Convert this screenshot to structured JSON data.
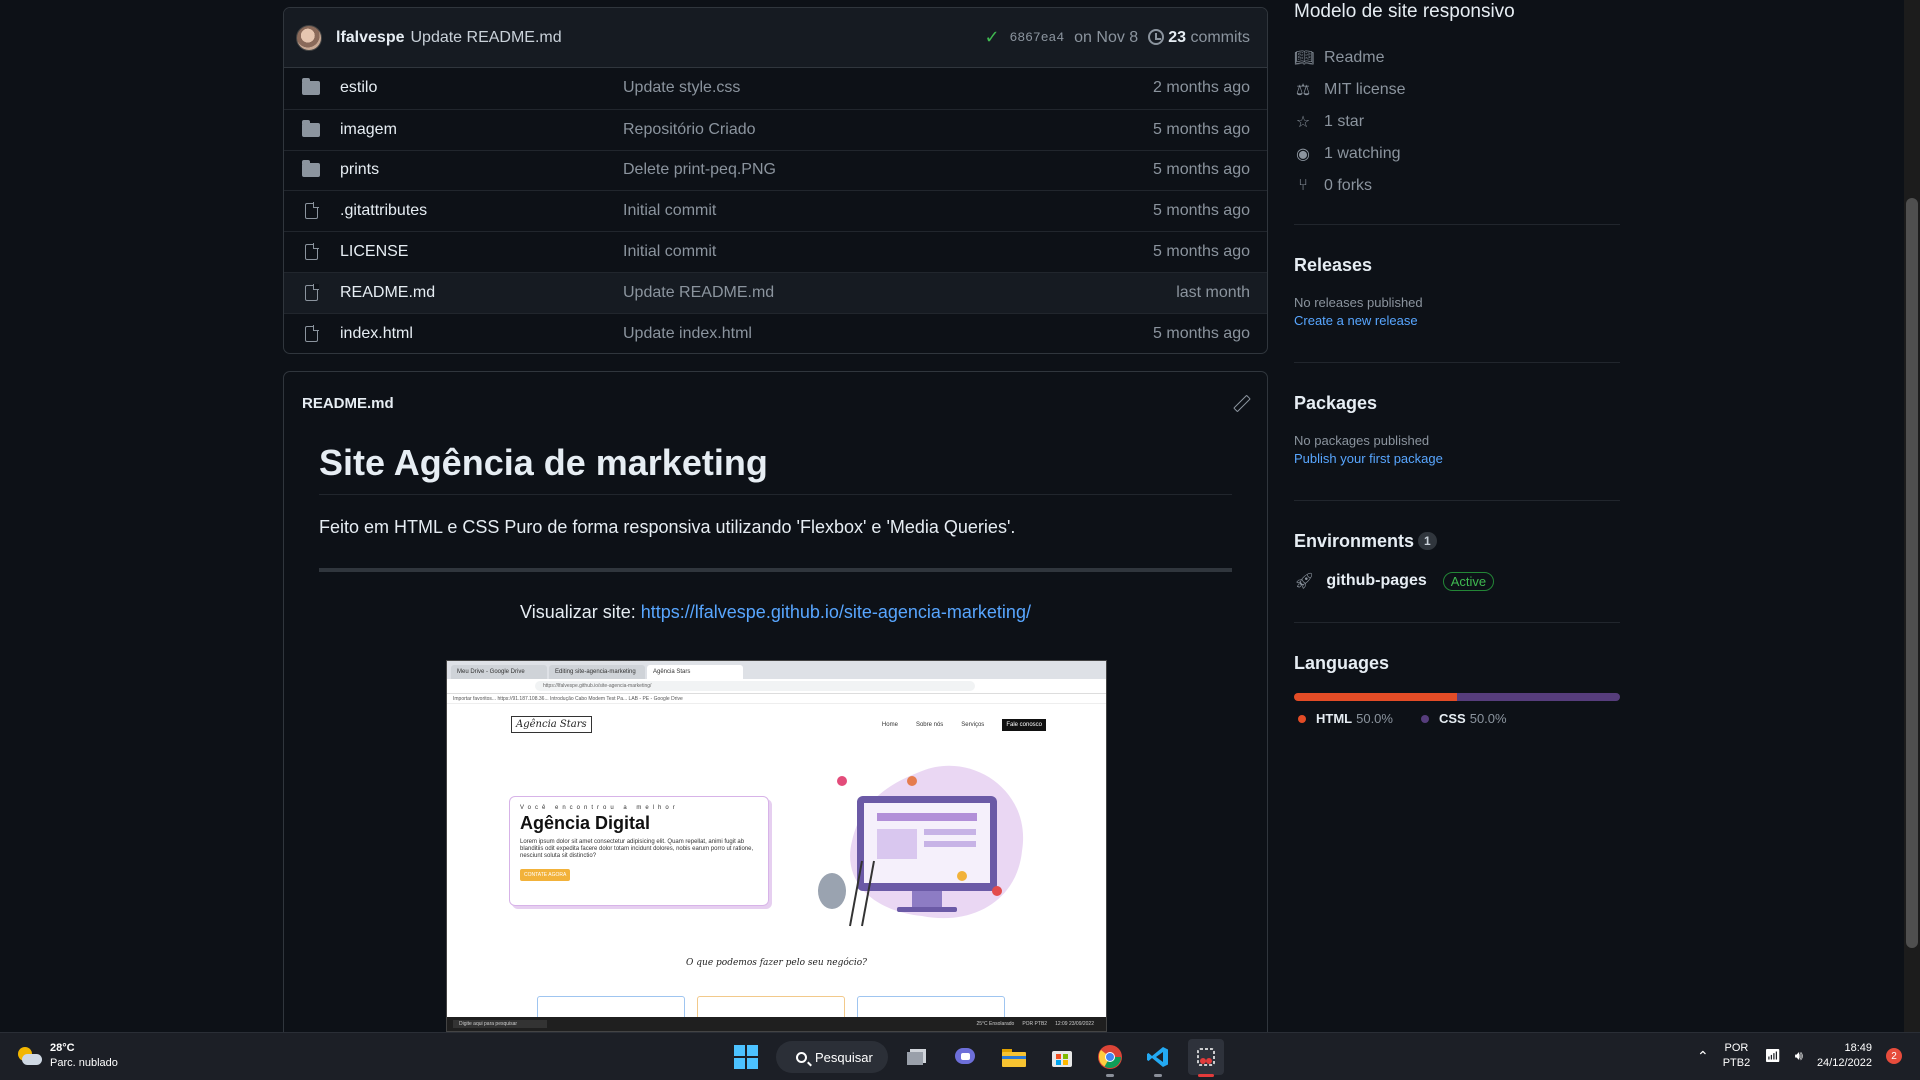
{
  "commit": {
    "author": "lfalvespe",
    "message": "Update README.md",
    "sha": "6867ea4",
    "date": "on Nov 8",
    "commits_count": "23",
    "commits_label": "commits"
  },
  "files": [
    {
      "name": "estilo",
      "type": "folder",
      "commit": "Update style.css",
      "date": "2 months ago"
    },
    {
      "name": "imagem",
      "type": "folder",
      "commit": "Repositório Criado",
      "date": "5 months ago"
    },
    {
      "name": "prints",
      "type": "folder",
      "commit": "Delete print-peq.PNG",
      "date": "5 months ago"
    },
    {
      "name": ".gitattributes",
      "type": "file",
      "commit": "Initial commit",
      "date": "5 months ago"
    },
    {
      "name": "LICENSE",
      "type": "file",
      "commit": "Initial commit",
      "date": "5 months ago"
    },
    {
      "name": "README.md",
      "type": "file",
      "commit": "Update README.md",
      "date": "last month"
    },
    {
      "name": "index.html",
      "type": "file",
      "commit": "Update index.html",
      "date": "5 months ago"
    }
  ],
  "readme": {
    "filename": "README.md",
    "title": "Site Agência de marketing",
    "description": "Feito em HTML e CSS Puro de forma responsiva utilizando 'Flexbox' e 'Media Queries'.",
    "visit_label": "Visualizar site:",
    "visit_url": "https://lfalvespe.github.io/site-agencia-marketing/"
  },
  "screenshot": {
    "tabs": [
      "Meu Drive - Google Drive",
      "Editing site-agencia-marketing",
      "Agência Stars"
    ],
    "url": "https://lfalvespe.github.io/site-agencia-marketing/",
    "bookmarks": "Importar favoritos...   https://91.187.108.36...   Introdução   Cabo Modem Test Pa...   LAB - PE - Google Drive",
    "logo": "Agência Stars",
    "menu": [
      "Home",
      "Sobre nós",
      "Serviços",
      "Fale conosco"
    ],
    "hero_small": "Você encontrou a melhor",
    "hero_big": "Agência Digital",
    "hero_text": "Lorem ipsum dolor sit amet consectetur adipisicing elit. Quam repellat, animi fugit ab blanditiis odit expedita facere dolor totam incidunt dolores, nobis earum porro ut ratione, nesciunt soluta sit distinctio?",
    "hero_button": "CONTATE AGORA",
    "question": "O que podemos fazer pelo seu negócio?",
    "task_search": "Digite aqui para pesquisar",
    "task_weather": "25°C Ensolarado",
    "task_lang": "POR PTB2",
    "task_time": "12:09 23/09/2022"
  },
  "sidebar": {
    "about": "Modelo de site responsivo",
    "meta": [
      {
        "icon": "book-icon",
        "label": "Readme"
      },
      {
        "icon": "scale-icon",
        "label": "MIT license"
      },
      {
        "icon": "star-icon",
        "label": "1 star"
      },
      {
        "icon": "eye-icon",
        "label": "1 watching"
      },
      {
        "icon": "fork-icon",
        "label": "0 forks"
      }
    ],
    "releases": {
      "title": "Releases",
      "empty": "No releases published",
      "link": "Create a new release"
    },
    "packages": {
      "title": "Packages",
      "empty": "No packages published",
      "link": "Publish your first package"
    },
    "environments": {
      "title": "Environments",
      "count": "1",
      "name": "github-pages",
      "status": "Active"
    },
    "languages": {
      "title": "Languages",
      "items": [
        {
          "name": "HTML",
          "percent": "50.0%",
          "fraction": 0.5,
          "color": "#e34c26"
        },
        {
          "name": "CSS",
          "percent": "50.0%",
          "fraction": 0.5,
          "color": "#563d7c"
        }
      ]
    }
  },
  "taskbar": {
    "weather_temp": "28°C",
    "weather_desc": "Parc. nublado",
    "search_label": "Pesquisar",
    "lang_top": "POR",
    "lang_bottom": "PTB2",
    "time": "18:49",
    "date": "24/12/2022",
    "notifications": "2"
  }
}
